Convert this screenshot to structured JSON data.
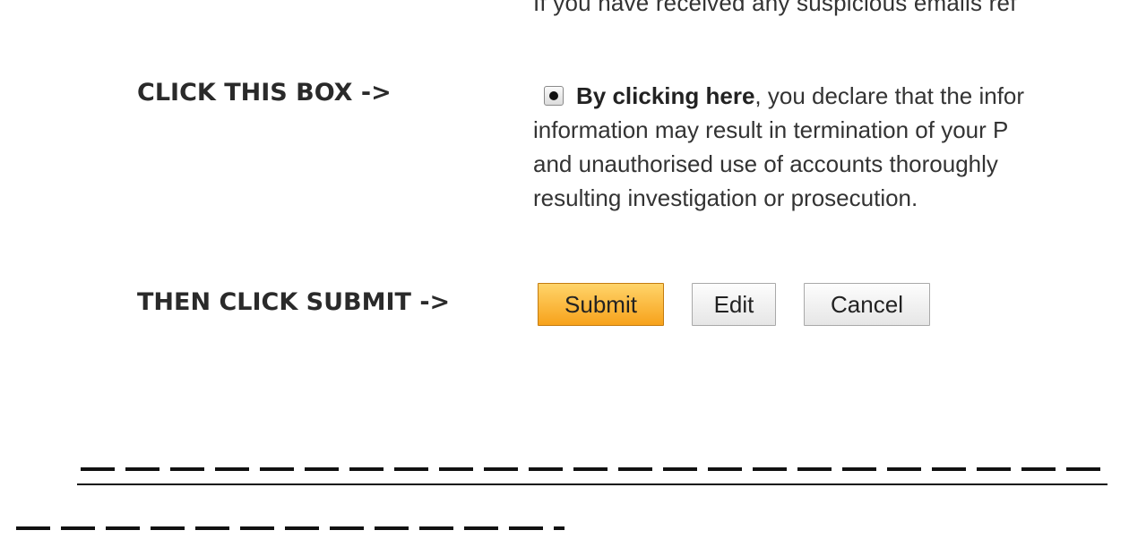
{
  "top_cut_text": "If you have received any suspicious emails ref",
  "labels": {
    "click_box": "CLICK THIS BOX ->",
    "then_submit": "THEN CLICK SUBMIT ->"
  },
  "declaration": {
    "checked": true,
    "bold": "By clicking here",
    "line1_rest": ", you declare that the infor",
    "line2": "information may result in termination of your P",
    "line3": "and unauthorised use of accounts thoroughly",
    "line4": "resulting investigation or prosecution."
  },
  "buttons": {
    "submit": "Submit",
    "edit": "Edit",
    "cancel": "Cancel"
  },
  "colors": {
    "submit_top": "#ffd46a",
    "submit_bottom": "#f7a21b"
  }
}
